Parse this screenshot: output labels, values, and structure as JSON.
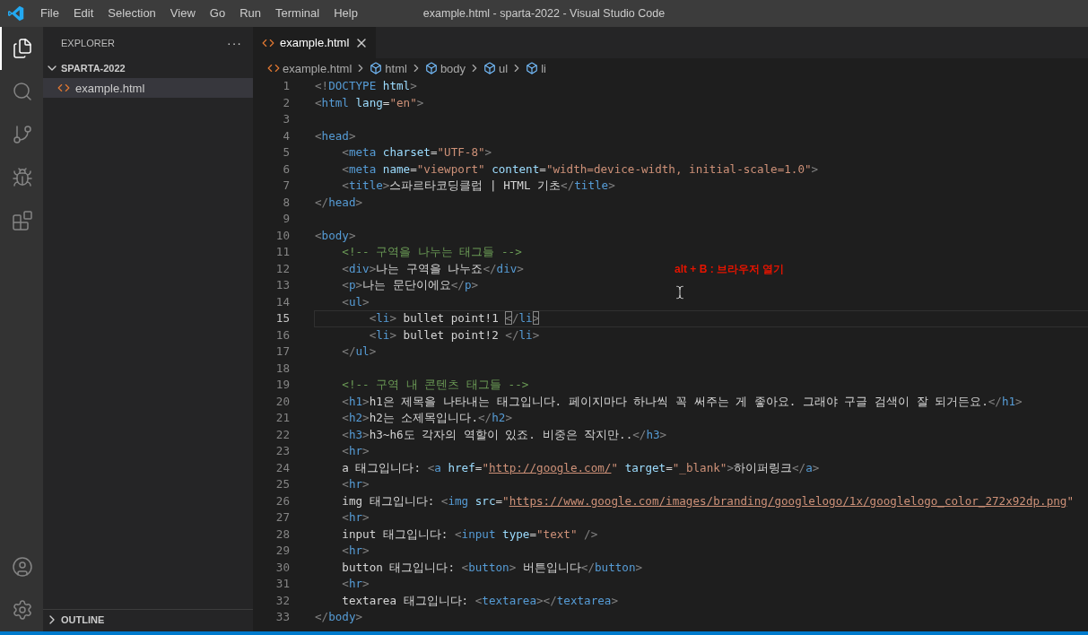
{
  "window": {
    "title": "example.html - sparta-2022 - Visual Studio Code"
  },
  "menu": [
    "File",
    "Edit",
    "Selection",
    "View",
    "Go",
    "Run",
    "Terminal",
    "Help"
  ],
  "activity_bar": [
    {
      "kind": "explorer",
      "selected": true
    },
    {
      "kind": "search",
      "selected": false
    },
    {
      "kind": "source-control",
      "selected": false
    },
    {
      "kind": "run",
      "selected": false
    },
    {
      "kind": "extensions",
      "selected": false
    }
  ],
  "activity_bar_bottom": [
    {
      "kind": "account"
    },
    {
      "kind": "settings"
    }
  ],
  "sidebar": {
    "title": "EXPLORER",
    "more": "···",
    "folder": {
      "name": "SPARTA-2022",
      "expanded": true,
      "files": [
        {
          "name": "example.html",
          "selected": true
        }
      ]
    },
    "outline": {
      "name": "OUTLINE",
      "expanded": false
    }
  },
  "tabs": [
    {
      "label": "example.html",
      "selected": true
    }
  ],
  "breadcrumbs": [
    {
      "label": "example.html",
      "kind": "file"
    },
    {
      "label": "html",
      "kind": "element"
    },
    {
      "label": "body",
      "kind": "element"
    },
    {
      "label": "ul",
      "kind": "element"
    },
    {
      "label": "li",
      "kind": "element"
    }
  ],
  "editor": {
    "lines": [
      {
        "number": "1",
        "current": false,
        "tokens": [
          {
            "kind": "punct",
            "text": "<!"
          },
          {
            "kind": "tag",
            "text": "DOCTYPE"
          },
          {
            "kind": "attr",
            "text": " html"
          },
          {
            "kind": "punct",
            "text": ">"
          }
        ]
      },
      {
        "number": "2",
        "current": false,
        "tokens": [
          {
            "kind": "punct",
            "text": "<"
          },
          {
            "kind": "tag",
            "text": "html"
          },
          {
            "kind": "attr",
            "text": " lang"
          },
          {
            "kind": "plain",
            "text": "="
          },
          {
            "kind": "string",
            "text": "\"en\""
          },
          {
            "kind": "punct",
            "text": ">"
          }
        ]
      },
      {
        "number": "3",
        "current": false
      },
      {
        "number": "4",
        "current": false,
        "tokens": [
          {
            "kind": "punct",
            "text": "<"
          },
          {
            "kind": "tag",
            "text": "head"
          },
          {
            "kind": "punct",
            "text": ">"
          }
        ]
      },
      {
        "number": "5",
        "current": false,
        "tokens": [
          {
            "kind": "punct",
            "text": "    <"
          },
          {
            "kind": "tag",
            "text": "meta"
          },
          {
            "kind": "attr",
            "text": " charset"
          },
          {
            "kind": "plain",
            "text": "="
          },
          {
            "kind": "string",
            "text": "\"UTF-8\""
          },
          {
            "kind": "punct",
            "text": ">"
          }
        ]
      },
      {
        "number": "6",
        "current": false,
        "tokens": [
          {
            "kind": "punct",
            "text": "    <"
          },
          {
            "kind": "tag",
            "text": "meta"
          },
          {
            "kind": "attr",
            "text": " name"
          },
          {
            "kind": "plain",
            "text": "="
          },
          {
            "kind": "string",
            "text": "\"viewport\""
          },
          {
            "kind": "attr",
            "text": " content"
          },
          {
            "kind": "plain",
            "text": "="
          },
          {
            "kind": "string",
            "text": "\"width=device-width, initial-scale=1.0\""
          },
          {
            "kind": "punct",
            "text": ">"
          }
        ]
      },
      {
        "number": "7",
        "current": false,
        "tokens": [
          {
            "kind": "punct",
            "text": "    <"
          },
          {
            "kind": "tag",
            "text": "title"
          },
          {
            "kind": "punct",
            "text": ">"
          },
          {
            "kind": "plain",
            "text": "스파르타코딩클럽 | HTML 기초"
          },
          {
            "kind": "punct",
            "text": "</"
          },
          {
            "kind": "tag",
            "text": "title"
          },
          {
            "kind": "punct",
            "text": ">"
          }
        ]
      },
      {
        "number": "8",
        "current": false,
        "tokens": [
          {
            "kind": "punct",
            "text": "</"
          },
          {
            "kind": "tag",
            "text": "head"
          },
          {
            "kind": "punct",
            "text": ">"
          }
        ]
      },
      {
        "number": "9",
        "current": false
      },
      {
        "number": "10",
        "current": false,
        "tokens": [
          {
            "kind": "punct",
            "text": "<"
          },
          {
            "kind": "tag",
            "text": "body"
          },
          {
            "kind": "punct",
            "text": ">"
          }
        ]
      },
      {
        "number": "11",
        "current": false,
        "tokens": [
          {
            "kind": "comment",
            "text": "    <!-- 구역을 나누는 태그들 -->"
          }
        ]
      },
      {
        "number": "12",
        "current": false,
        "tokens": [
          {
            "kind": "punct",
            "text": "    <"
          },
          {
            "kind": "tag",
            "text": "div"
          },
          {
            "kind": "punct",
            "text": ">"
          },
          {
            "kind": "plain",
            "text": "나는 구역을 나누죠"
          },
          {
            "kind": "punct",
            "text": "</"
          },
          {
            "kind": "tag",
            "text": "div"
          },
          {
            "kind": "punct",
            "text": ">"
          }
        ]
      },
      {
        "number": "13",
        "current": false,
        "tokens": [
          {
            "kind": "punct",
            "text": "    <"
          },
          {
            "kind": "tag",
            "text": "p"
          },
          {
            "kind": "punct",
            "text": ">"
          },
          {
            "kind": "plain",
            "text": "나는 문단이에요"
          },
          {
            "kind": "punct",
            "text": "</"
          },
          {
            "kind": "tag",
            "text": "p"
          },
          {
            "kind": "punct",
            "text": ">"
          }
        ]
      },
      {
        "number": "14",
        "current": false,
        "tokens": [
          {
            "kind": "punct",
            "text": "    <"
          },
          {
            "kind": "tag",
            "text": "ul"
          },
          {
            "kind": "punct",
            "text": ">"
          }
        ]
      },
      {
        "number": "15",
        "current": true,
        "tokens": [
          {
            "kind": "punct",
            "text": "        <"
          },
          {
            "kind": "tag",
            "text": "li"
          },
          {
            "kind": "punct",
            "text": ">"
          },
          {
            "kind": "plain",
            "text": " bullet point!1 "
          },
          {
            "kind": "bracket-match",
            "text": "<"
          },
          {
            "kind": "punct",
            "text": "/"
          },
          {
            "kind": "tag",
            "text": "li"
          },
          {
            "kind": "bracket-match",
            "text": ">"
          }
        ]
      },
      {
        "number": "16",
        "current": false,
        "tokens": [
          {
            "kind": "punct",
            "text": "        <"
          },
          {
            "kind": "tag",
            "text": "li"
          },
          {
            "kind": "punct",
            "text": ">"
          },
          {
            "kind": "plain",
            "text": " bullet point!2 "
          },
          {
            "kind": "punct",
            "text": "</"
          },
          {
            "kind": "tag",
            "text": "li"
          },
          {
            "kind": "punct",
            "text": ">"
          }
        ]
      },
      {
        "number": "17",
        "current": false,
        "tokens": [
          {
            "kind": "punct",
            "text": "    </"
          },
          {
            "kind": "tag",
            "text": "ul"
          },
          {
            "kind": "punct",
            "text": ">"
          }
        ]
      },
      {
        "number": "18",
        "current": false
      },
      {
        "number": "19",
        "current": false,
        "tokens": [
          {
            "kind": "comment",
            "text": "    <!-- 구역 내 콘텐츠 태그들 -->"
          }
        ]
      },
      {
        "number": "20",
        "current": false,
        "tokens": [
          {
            "kind": "punct",
            "text": "    <"
          },
          {
            "kind": "tag",
            "text": "h1"
          },
          {
            "kind": "punct",
            "text": ">"
          },
          {
            "kind": "plain",
            "text": "h1은 제목을 나타내는 태그입니다. 페이지마다 하나씩 꼭 써주는 게 좋아요. 그래야 구글 검색이 잘 되거든요."
          },
          {
            "kind": "punct",
            "text": "</"
          },
          {
            "kind": "tag",
            "text": "h1"
          },
          {
            "kind": "punct",
            "text": ">"
          }
        ]
      },
      {
        "number": "21",
        "current": false,
        "tokens": [
          {
            "kind": "punct",
            "text": "    <"
          },
          {
            "kind": "tag",
            "text": "h2"
          },
          {
            "kind": "punct",
            "text": ">"
          },
          {
            "kind": "plain",
            "text": "h2는 소제목입니다."
          },
          {
            "kind": "punct",
            "text": "</"
          },
          {
            "kind": "tag",
            "text": "h2"
          },
          {
            "kind": "punct",
            "text": ">"
          }
        ]
      },
      {
        "number": "22",
        "current": false,
        "tokens": [
          {
            "kind": "punct",
            "text": "    <"
          },
          {
            "kind": "tag",
            "text": "h3"
          },
          {
            "kind": "punct",
            "text": ">"
          },
          {
            "kind": "plain",
            "text": "h3~h6도 각자의 역할이 있죠. 비중은 작지만.."
          },
          {
            "kind": "punct",
            "text": "</"
          },
          {
            "kind": "tag",
            "text": "h3"
          },
          {
            "kind": "punct",
            "text": ">"
          }
        ]
      },
      {
        "number": "23",
        "current": false,
        "tokens": [
          {
            "kind": "punct",
            "text": "    <"
          },
          {
            "kind": "tag",
            "text": "hr"
          },
          {
            "kind": "punct",
            "text": ">"
          }
        ]
      },
      {
        "number": "24",
        "current": false,
        "tokens": [
          {
            "kind": "plain",
            "text": "    a 태그입니다: "
          },
          {
            "kind": "punct",
            "text": "<"
          },
          {
            "kind": "tag",
            "text": "a"
          },
          {
            "kind": "attr",
            "text": " href"
          },
          {
            "kind": "plain",
            "text": "="
          },
          {
            "kind": "string",
            "text": "\""
          },
          {
            "kind": "link",
            "text": "http://google.com/"
          },
          {
            "kind": "string",
            "text": "\""
          },
          {
            "kind": "attr",
            "text": " target"
          },
          {
            "kind": "plain",
            "text": "="
          },
          {
            "kind": "string",
            "text": "\"_blank\""
          },
          {
            "kind": "punct",
            "text": ">"
          },
          {
            "kind": "plain",
            "text": "하이퍼링크"
          },
          {
            "kind": "punct",
            "text": "</"
          },
          {
            "kind": "tag",
            "text": "a"
          },
          {
            "kind": "punct",
            "text": ">"
          }
        ]
      },
      {
        "number": "25",
        "current": false,
        "tokens": [
          {
            "kind": "punct",
            "text": "    <"
          },
          {
            "kind": "tag",
            "text": "hr"
          },
          {
            "kind": "punct",
            "text": ">"
          }
        ]
      },
      {
        "number": "26",
        "current": false,
        "tokens": [
          {
            "kind": "plain",
            "text": "    img 태그입니다: "
          },
          {
            "kind": "punct",
            "text": "<"
          },
          {
            "kind": "tag",
            "text": "img"
          },
          {
            "kind": "attr",
            "text": " src"
          },
          {
            "kind": "plain",
            "text": "="
          },
          {
            "kind": "string",
            "text": "\""
          },
          {
            "kind": "link",
            "text": "https://www.google.com/images/branding/googlelogo/1x/googlelogo_color_272x92dp.png"
          },
          {
            "kind": "string",
            "text": "\""
          }
        ]
      },
      {
        "number": "27",
        "current": false,
        "tokens": [
          {
            "kind": "punct",
            "text": "    <"
          },
          {
            "kind": "tag",
            "text": "hr"
          },
          {
            "kind": "punct",
            "text": ">"
          }
        ]
      },
      {
        "number": "28",
        "current": false,
        "tokens": [
          {
            "kind": "plain",
            "text": "    input 태그입니다: "
          },
          {
            "kind": "punct",
            "text": "<"
          },
          {
            "kind": "tag",
            "text": "input"
          },
          {
            "kind": "attr",
            "text": " type"
          },
          {
            "kind": "plain",
            "text": "="
          },
          {
            "kind": "string",
            "text": "\"text\""
          },
          {
            "kind": "punct",
            "text": " />"
          }
        ]
      },
      {
        "number": "29",
        "current": false,
        "tokens": [
          {
            "kind": "punct",
            "text": "    <"
          },
          {
            "kind": "tag",
            "text": "hr"
          },
          {
            "kind": "punct",
            "text": ">"
          }
        ]
      },
      {
        "number": "30",
        "current": false,
        "tokens": [
          {
            "kind": "plain",
            "text": "    button 태그입니다: "
          },
          {
            "kind": "punct",
            "text": "<"
          },
          {
            "kind": "tag",
            "text": "button"
          },
          {
            "kind": "punct",
            "text": ">"
          },
          {
            "kind": "plain",
            "text": " 버튼입니다"
          },
          {
            "kind": "punct",
            "text": "</"
          },
          {
            "kind": "tag",
            "text": "button"
          },
          {
            "kind": "punct",
            "text": ">"
          }
        ]
      },
      {
        "number": "31",
        "current": false,
        "tokens": [
          {
            "kind": "punct",
            "text": "    <"
          },
          {
            "kind": "tag",
            "text": "hr"
          },
          {
            "kind": "punct",
            "text": ">"
          }
        ]
      },
      {
        "number": "32",
        "current": false,
        "tokens": [
          {
            "kind": "plain",
            "text": "    textarea 태그입니다: "
          },
          {
            "kind": "punct",
            "text": "<"
          },
          {
            "kind": "tag",
            "text": "textarea"
          },
          {
            "kind": "punct",
            "text": "></"
          },
          {
            "kind": "tag",
            "text": "textarea"
          },
          {
            "kind": "punct",
            "text": ">"
          }
        ]
      },
      {
        "number": "33",
        "current": false,
        "tokens": [
          {
            "kind": "punct",
            "text": "</"
          },
          {
            "kind": "tag",
            "text": "body"
          },
          {
            "kind": "punct",
            "text": ">"
          }
        ]
      }
    ]
  },
  "annotation": {
    "text": "alt + B : 브라우저 열기",
    "color": "#e51400"
  }
}
